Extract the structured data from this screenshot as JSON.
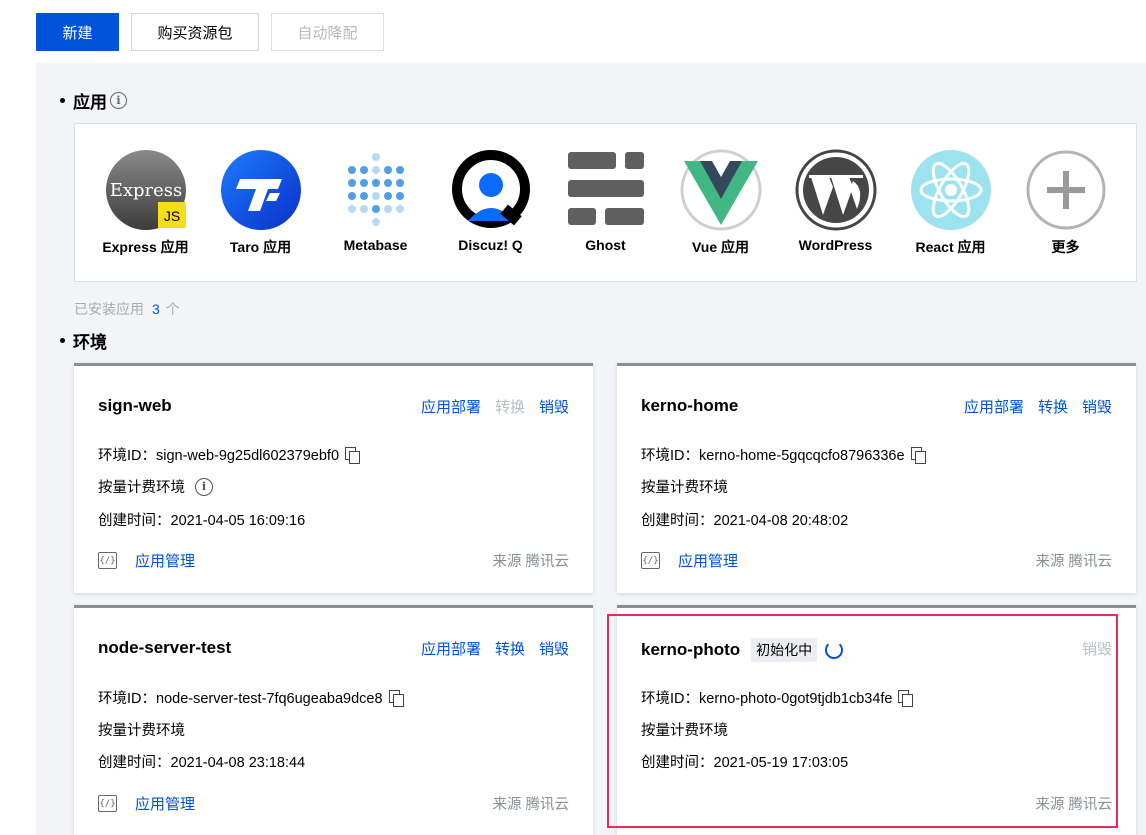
{
  "toolbar": {
    "new_label": "新建",
    "buy_label": "购买资源包",
    "auto_label": "自动降配"
  },
  "apps_section": {
    "title": "应用",
    "items": [
      {
        "name": "Express 应用",
        "icon": "express-icon",
        "logo_text": "Express",
        "badge": "JS"
      },
      {
        "name": "Taro 应用",
        "icon": "taro-icon"
      },
      {
        "name": "Metabase",
        "icon": "metabase-icon"
      },
      {
        "name": "Discuz! Q",
        "icon": "discuz-icon"
      },
      {
        "name": "Ghost",
        "icon": "ghost-icon"
      },
      {
        "name": "Vue 应用",
        "icon": "vue-icon"
      },
      {
        "name": "WordPress",
        "icon": "wordpress-icon"
      },
      {
        "name": "React 应用",
        "icon": "react-icon"
      },
      {
        "name": "更多",
        "icon": "plus-icon"
      }
    ],
    "installed_label": "已安装应用",
    "installed_count": "3",
    "installed_unit": "个"
  },
  "env_section": {
    "title": "环境",
    "cards": [
      {
        "name": "sign-web",
        "actions": [
          {
            "label": "应用部署",
            "enabled": true
          },
          {
            "label": "转换",
            "enabled": false
          },
          {
            "label": "销毁",
            "enabled": true
          }
        ],
        "env_id": "环境ID：sign-web-9g25dl602379ebf0",
        "billing": "按量计费环境",
        "created": "创建时间：2021-04-05 16:09:16",
        "manage_label": "应用管理",
        "source": "来源 腾讯云"
      },
      {
        "name": "kerno-home",
        "actions": [
          {
            "label": "应用部署",
            "enabled": true
          },
          {
            "label": "转换",
            "enabled": true
          },
          {
            "label": "销毁",
            "enabled": true
          }
        ],
        "env_id": "环境ID：kerno-home-5gqcqcfo8796336e",
        "billing": "按量计费环境",
        "created": "创建时间：2021-04-08 20:48:02",
        "manage_label": "应用管理",
        "source": "来源 腾讯云"
      },
      {
        "name": "node-server-test",
        "actions": [
          {
            "label": "应用部署",
            "enabled": true
          },
          {
            "label": "转换",
            "enabled": true
          },
          {
            "label": "销毁",
            "enabled": true
          }
        ],
        "env_id": "环境ID：node-server-test-7fq6ugeaba9dce8",
        "billing": "按量计费环境",
        "created": "创建时间：2021-04-08 23:18:44",
        "manage_label": "应用管理",
        "source": "来源 腾讯云"
      },
      {
        "name": "kerno-photo",
        "status": "初始化中",
        "actions": [
          {
            "label": "销毁",
            "enabled": false
          }
        ],
        "env_id": "环境ID：kerno-photo-0got9tjdb1cb34fe",
        "billing": "按量计费环境",
        "created": "创建时间：2021-05-19 17:03:05",
        "source": "来源 腾讯云"
      }
    ]
  },
  "colors": {
    "primary": "#0052d9",
    "panel_bg": "#f3f4f7",
    "highlight": "#e02d5a",
    "disabled": "#b8bcc4"
  }
}
